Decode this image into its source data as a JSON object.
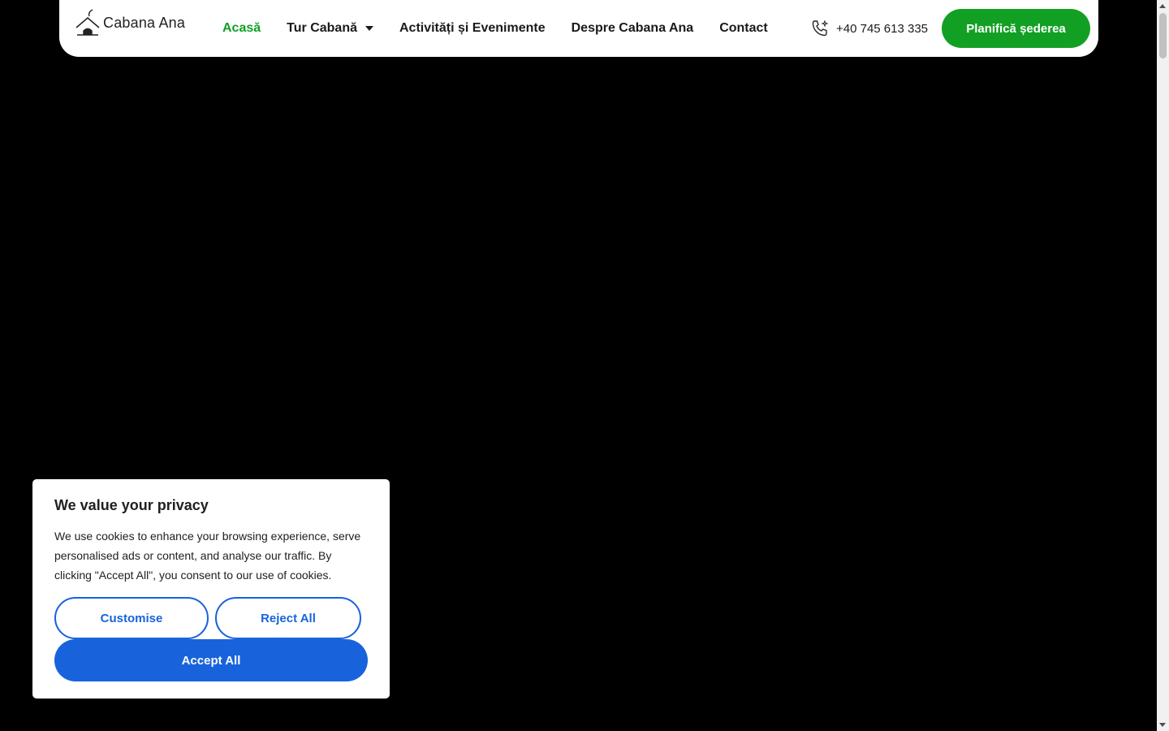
{
  "header": {
    "logo_text": "Cabana Ana",
    "nav": [
      {
        "label": "Acasă",
        "active": true
      },
      {
        "label": "Tur Cabană",
        "has_dropdown": true
      },
      {
        "label": "Activități și Evenimente"
      },
      {
        "label": "Despre Cabana Ana"
      },
      {
        "label": "Contact"
      }
    ],
    "phone": "+40 745 613 335",
    "cta_label": "Planifică șederea"
  },
  "cookie_banner": {
    "title": "We value your privacy",
    "text": "We use cookies to enhance your browsing experience, serve personalised ads or content, and analyse our traffic. By clicking \"Accept All\", you consent to our use of cookies.",
    "customise_label": "Customise",
    "reject_label": "Reject All",
    "accept_label": "Accept All"
  },
  "colors": {
    "brand_green": "#12a024",
    "cookie_blue": "#1863dc",
    "hero_background": "#000000"
  },
  "icons": {
    "logo": "house-logo-icon",
    "phone": "phone-icon",
    "dropdown": "caret-down-icon"
  }
}
